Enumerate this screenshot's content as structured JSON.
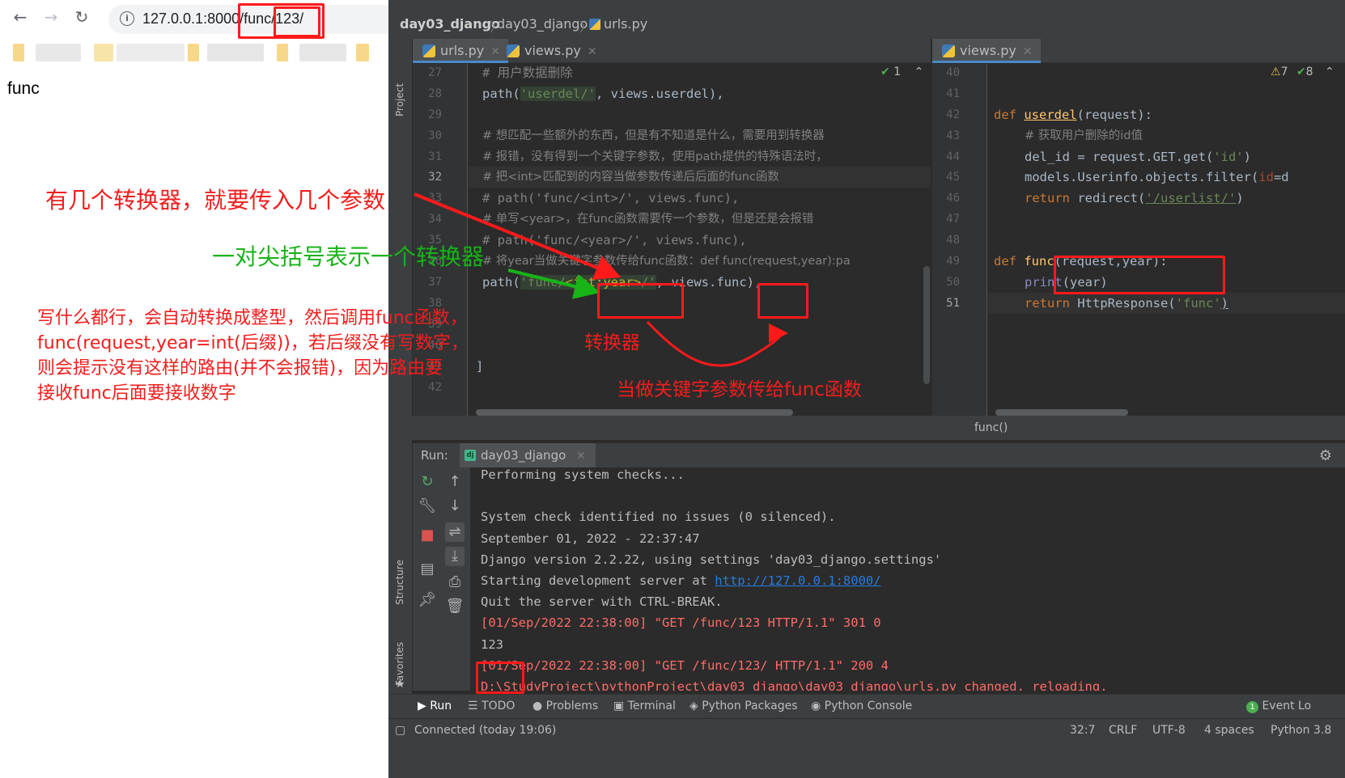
{
  "browser": {
    "back_glyph": "←",
    "forward_glyph": "→",
    "reload_glyph": "↻",
    "url_prefix": "127.0.0.1:8000/func/",
    "url_suffix": "123/",
    "info_glyph": "i",
    "page_text": "func"
  },
  "ide": {
    "breadcrumbs": [
      "day03_django",
      "day03_django",
      "urls.py"
    ],
    "left_tool_labels": [
      "Project",
      "Structure",
      "Favorites"
    ],
    "left_tabs": [
      {
        "label": "urls.py",
        "active": true
      },
      {
        "label": "views.py",
        "active": false
      }
    ],
    "right_tabs": [
      {
        "label": "views.py",
        "active": true
      }
    ],
    "left_inspection": {
      "ok_count": "1"
    },
    "right_inspection": {
      "warn_count": "7",
      "ok_count": "8"
    },
    "left_code": {
      "line_numbers": [
        "27",
        "28",
        "29",
        "30",
        "31",
        "32",
        "33",
        "34",
        "35",
        "36",
        "37",
        "38",
        "39",
        "40",
        "41",
        "42"
      ],
      "current_line": "32",
      "lines": {
        "l27": "# 用户数据删除",
        "l28_a": "path(",
        "l28_str": "'userdel/'",
        "l28_b": ", views.userdel),",
        "l30": "# 想匹配一些额外的东西，但是有不知道是什么，需要用到转换器",
        "l31": "# 报错，没有得到一个关键字参数，使用path提供的特殊语法时，",
        "l32": "# 把<int>匹配到的内容当做参数传递后后面的func函数",
        "l33": "# path('func/<int>/', views.func),",
        "l34": "# 单写<year>，在func函数需要传一个参数，但是还是会报错",
        "l35": "# path('func/<year>/', views.func),",
        "l36": "# 将year当做关键字参数传给func函数：def func(request,year):pa",
        "l37_a": "path(",
        "l37_str1": "'func/",
        "l37_conv": "<int:year>",
        "l37_str2": "/'",
        "l37_b": ", views.",
        "l37_fn": "func",
        "l37_c": "),",
        "l41": "]"
      }
    },
    "right_code": {
      "line_numbers": [
        "40",
        "41",
        "42",
        "43",
        "44",
        "45",
        "46",
        "47",
        "48",
        "49",
        "50",
        "51"
      ],
      "current_line": "51",
      "lines": {
        "l42_kw": "def ",
        "l42_fn": "userdel",
        "l42_rest": "(request):",
        "l43": "# 获取用户删除的id值",
        "l44_a": "del_id = request.GET.get(",
        "l44_str": "'id'",
        "l44_b": ")",
        "l45_a": "models.Userinfo.objects.filter(",
        "l45_kw": "id",
        "l45_b": "=d",
        "l46_kw": "return ",
        "l46_a": "redirect(",
        "l46_str": "'/userlist/'",
        "l46_b": ")",
        "l49_kw": "def ",
        "l49_fn": "func",
        "l49_rest": "(request,year):",
        "l50_builtin": "print",
        "l50_rest": "(year)",
        "l51_kw": "return ",
        "l51_a": "HttpResponse(",
        "l51_str": "'func'",
        "l51_b": ")"
      }
    },
    "hint": "func()",
    "run": {
      "label": "Run:",
      "tab": "day03_django",
      "django_glyph": "dj",
      "console": [
        {
          "text": "Performing system checks...",
          "kind": "normal"
        },
        {
          "text": "",
          "kind": "normal"
        },
        {
          "text": "System check identified no issues (0 silenced).",
          "kind": "normal"
        },
        {
          "text": "September 01, 2022 - 22:37:47",
          "kind": "normal"
        },
        {
          "text": "Django version 2.2.22, using settings 'day03_django.settings'",
          "kind": "normal"
        },
        {
          "text": "Starting development server at ",
          "kind": "normal",
          "link": "http://127.0.0.1:8000/"
        },
        {
          "text": "Quit the server with CTRL-BREAK.",
          "kind": "normal"
        },
        {
          "text": "[01/Sep/2022 22:38:00] \"GET /func/123 HTTP/1.1\" 301 0",
          "kind": "error"
        },
        {
          "text": "123",
          "kind": "normal"
        },
        {
          "text": "[01/Sep/2022 22:38:00] \"GET /func/123/ HTTP/1.1\" 200 4",
          "kind": "error"
        },
        {
          "text": "D:\\StudyProject\\pythonProject\\day03_django\\day03_django\\urls.py changed, reloading.",
          "kind": "error"
        }
      ]
    },
    "bottom_tools": [
      "Run",
      "TODO",
      "Problems",
      "Terminal",
      "Python Packages",
      "Python Console",
      "Event Lo"
    ],
    "event_count": "1",
    "status": {
      "connection": "Connected (today 19:06)",
      "position": "32:7",
      "line_sep": "CRLF",
      "encoding": "UTF-8",
      "indent": "4 spaces",
      "interpreter": "Python 3.8"
    }
  },
  "annotations": {
    "converters_params": "有几个转换器，就要传入几个参数",
    "angle_brackets": "一对尖括号表示一个转换器",
    "explanation": [
      "写什么都行，会自动转换成整型，然后调用func函数，",
      "func(request,year=int(后缀))，若后缀没有写数字，",
      "则会提示没有这样的路由(并不会报错)，因为路由要",
      "接收func后面要接收数字"
    ],
    "converter_label": "转换器",
    "kwarg_label": "当做关键字参数传给func函数"
  },
  "colors": {
    "annotation_red": "#f21d1d",
    "annotation_green": "#17b317",
    "box_red": "#ff1a1a",
    "ide_bg": "#2b2b2b",
    "ide_panel": "#3c3f41"
  }
}
